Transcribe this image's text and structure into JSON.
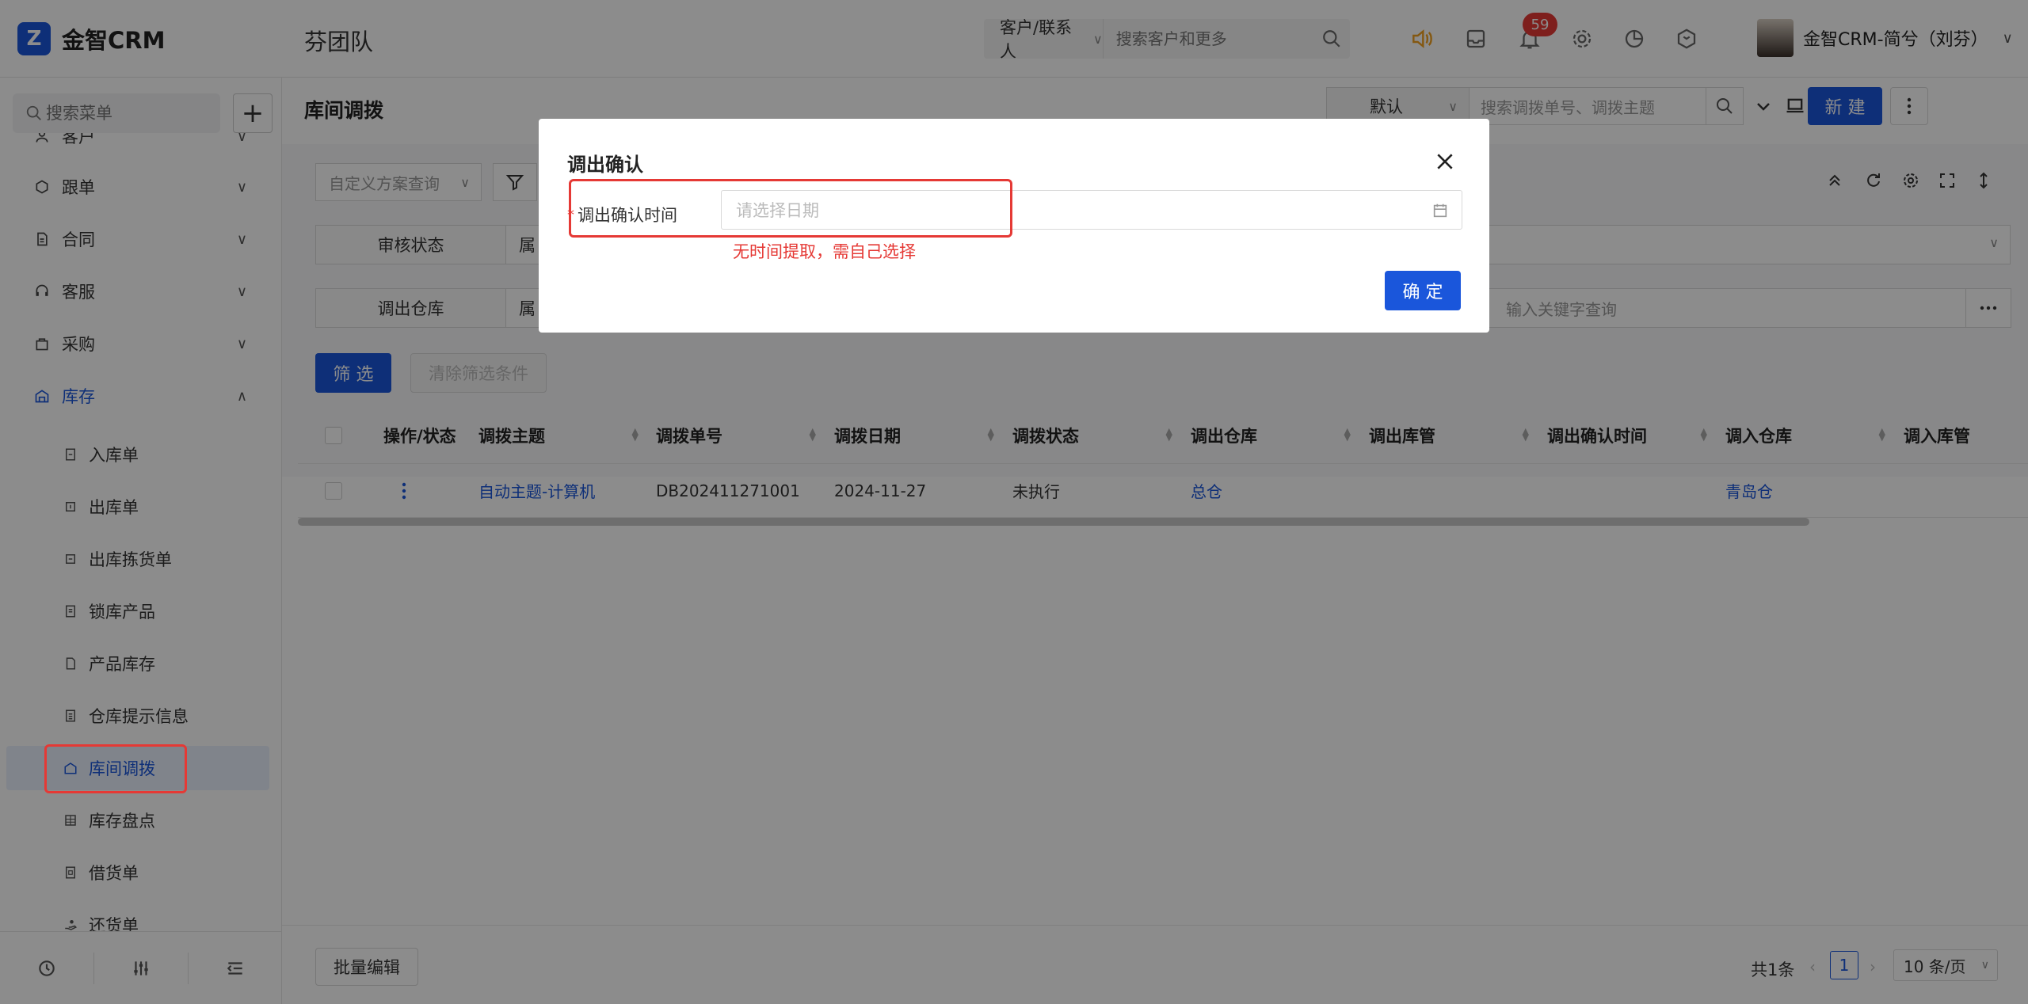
{
  "header": {
    "logo_text": "金智CRM",
    "team_name": "芬团队",
    "search_type": "客户/联系人",
    "search_placeholder": "搜索客户和更多",
    "badge_count": "59",
    "user_name": "金智CRM-简兮（刘芬）",
    "colors": {
      "accent": "#1a56db",
      "badge": "#e53935",
      "speaker": "#f0a020"
    },
    "icons": [
      "speaker-icon",
      "inbox-icon",
      "bell-icon",
      "gear-icon",
      "pie-chart-icon",
      "cube-icon"
    ]
  },
  "sidebar": {
    "search_placeholder": "搜索菜单",
    "menu": [
      {
        "label": "客户",
        "icon": "user-icon"
      },
      {
        "label": "跟单",
        "icon": "track-icon"
      },
      {
        "label": "合同",
        "icon": "contract-icon"
      },
      {
        "label": "客服",
        "icon": "service-icon"
      },
      {
        "label": "采购",
        "icon": "bag-icon"
      },
      {
        "label": "库存",
        "icon": "warehouse-icon"
      }
    ],
    "sub_items": [
      {
        "label": "入库单"
      },
      {
        "label": "出库单"
      },
      {
        "label": "出库拣货单"
      },
      {
        "label": "锁库产品"
      },
      {
        "label": "产品库存"
      },
      {
        "label": "仓库提示信息"
      },
      {
        "label": "库间调拨"
      },
      {
        "label": "库存盘点"
      },
      {
        "label": "借货单"
      },
      {
        "label": "还货单"
      }
    ],
    "active_sub": "库间调拨"
  },
  "main": {
    "page_title": "库间调拨",
    "view_select": "默认",
    "search_placeholder": "搜索调拨单号、调拨主题",
    "new_button": "新 建",
    "custom_query_placeholder": "自定义方案查询",
    "filters": [
      {
        "label": "审核状态",
        "value": "属"
      },
      {
        "label": "调出仓库",
        "value": "属",
        "right_placeholder": "输入关键字查询"
      }
    ],
    "filter_button": "筛 选",
    "clear_button": "清除筛选条件",
    "table": {
      "headers": [
        "操作/状态",
        "调拨主题",
        "调拨单号",
        "调拨日期",
        "调拨状态",
        "调出仓库",
        "调出库管",
        "调出确认时间",
        "调入仓库",
        "调入库管"
      ],
      "rows": [
        {
          "subject": "自动主题-计算机",
          "number": "DB202411271001",
          "date": "2024-11-27",
          "status": "未执行",
          "out_warehouse": "总仓",
          "out_manager": "",
          "confirm_time": "",
          "in_warehouse": "青岛仓",
          "in_manager": ""
        }
      ]
    },
    "batch_edit": "批量编辑",
    "total_text": "共1条",
    "current_page": "1",
    "page_size": "10 条/页"
  },
  "modal": {
    "title": "调出确认",
    "field_label": "调出确认时间",
    "required_mark": "*",
    "date_placeholder": "请选择日期",
    "annotation": "无时间提取，需自己选择",
    "ok_button": "确 定"
  }
}
